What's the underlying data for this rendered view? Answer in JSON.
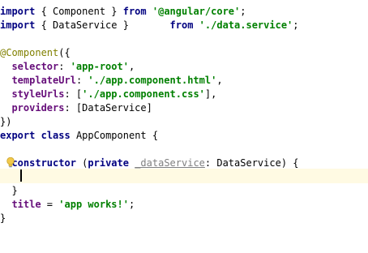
{
  "editor": {
    "lines": [
      [
        {
          "t": "import",
          "c": "kw"
        },
        {
          "t": " { Component } ",
          "c": ""
        },
        {
          "t": "from",
          "c": "kw"
        },
        {
          "t": " ",
          "c": ""
        },
        {
          "t": "'@angular/core'",
          "c": "str"
        },
        {
          "t": ";",
          "c": ""
        }
      ],
      [
        {
          "t": "import",
          "c": "kw"
        },
        {
          "t": " { DataService }       ",
          "c": ""
        },
        {
          "t": "from",
          "c": "kw"
        },
        {
          "t": " ",
          "c": ""
        },
        {
          "t": "'./data.service'",
          "c": "str"
        },
        {
          "t": ";",
          "c": ""
        }
      ],
      [],
      [
        {
          "t": "@Component",
          "c": "anno"
        },
        {
          "t": "({",
          "c": ""
        }
      ],
      [
        {
          "t": "  ",
          "c": ""
        },
        {
          "t": "selector",
          "c": "prop"
        },
        {
          "t": ": ",
          "c": ""
        },
        {
          "t": "'app-root'",
          "c": "str"
        },
        {
          "t": ",",
          "c": ""
        }
      ],
      [
        {
          "t": "  ",
          "c": ""
        },
        {
          "t": "templateUrl",
          "c": "prop"
        },
        {
          "t": ": ",
          "c": ""
        },
        {
          "t": "'./app.component.html'",
          "c": "str"
        },
        {
          "t": ",",
          "c": ""
        }
      ],
      [
        {
          "t": "  ",
          "c": ""
        },
        {
          "t": "styleUrls",
          "c": "prop"
        },
        {
          "t": ": [",
          "c": ""
        },
        {
          "t": "'./app.component.css'",
          "c": "str"
        },
        {
          "t": "],",
          "c": ""
        }
      ],
      [
        {
          "t": "  ",
          "c": ""
        },
        {
          "t": "providers",
          "c": "prop"
        },
        {
          "t": ": [DataService]",
          "c": ""
        }
      ],
      [
        {
          "t": "})",
          "c": ""
        }
      ],
      [
        {
          "t": "export",
          "c": "kw"
        },
        {
          "t": " ",
          "c": ""
        },
        {
          "t": "class",
          "c": "kw"
        },
        {
          "t": " AppComponent {",
          "c": ""
        }
      ],
      [],
      [
        {
          "t": "  ",
          "c": ""
        },
        {
          "t": "constructor",
          "c": "kw"
        },
        {
          "t": " (",
          "c": ""
        },
        {
          "t": "private",
          "c": "kw"
        },
        {
          "t": " ",
          "c": ""
        },
        {
          "t": "_dataService",
          "c": "unused"
        },
        {
          "t": ": DataService) {",
          "c": ""
        }
      ],
      [],
      [
        {
          "t": "  }",
          "c": ""
        }
      ],
      [
        {
          "t": "  ",
          "c": ""
        },
        {
          "t": "title",
          "c": "prop"
        },
        {
          "t": " = ",
          "c": ""
        },
        {
          "t": "'app works!'",
          "c": "str"
        },
        {
          "t": ";",
          "c": ""
        }
      ],
      [
        {
          "t": "}",
          "c": ""
        }
      ]
    ]
  },
  "colors": {
    "keyword": "#000080",
    "string": "#008000",
    "property": "#660e7a",
    "annotation": "#808000",
    "unused": "#808080",
    "caret_row": "#fffae3"
  },
  "icons": {
    "intention_bulb": "lightbulb-icon"
  }
}
